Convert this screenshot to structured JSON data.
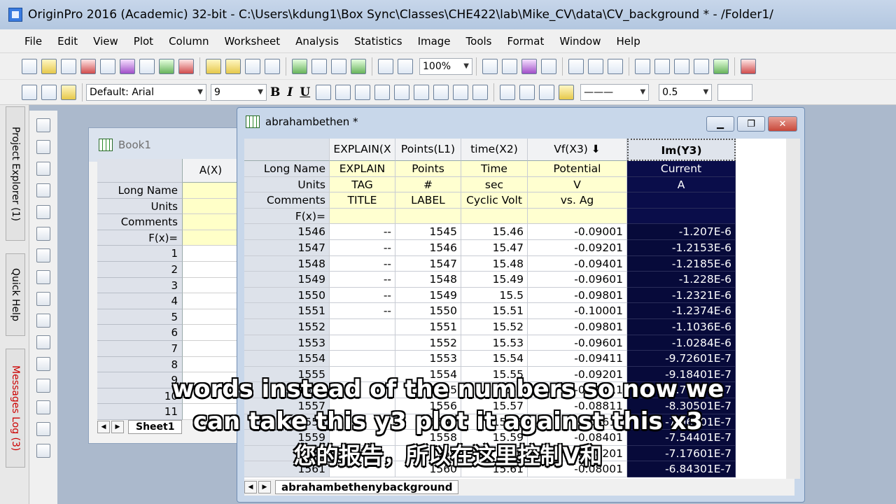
{
  "app": {
    "title": "OriginPro 2016 (Academic) 32-bit - C:\\Users\\kdung1\\Box Sync\\Classes\\CHE422\\lab\\Mike_CV\\data\\CV_background * - /Folder1/"
  },
  "menu": [
    "File",
    "Edit",
    "View",
    "Plot",
    "Column",
    "Worksheet",
    "Analysis",
    "Statistics",
    "Image",
    "Tools",
    "Format",
    "Window",
    "Help"
  ],
  "toolbar": {
    "zoom": "100%",
    "font": "Default: Arial",
    "size": "9",
    "line_width": "0.5"
  },
  "dock_tabs": [
    "Project Explorer (1)",
    "Quick Help",
    "Messages Log (3)"
  ],
  "book1": {
    "title": "Book1",
    "column": "A(X)",
    "labels": [
      "Long Name",
      "Units",
      "Comments",
      "F(x)=",
      "1",
      "2",
      "3",
      "4",
      "5",
      "6",
      "7",
      "8",
      "9",
      "10",
      "11"
    ],
    "sheet_tab": "Sheet1"
  },
  "workbook": {
    "title": "abrahambethen *",
    "sheet_tab": "abrahambethenybackground",
    "columns": [
      "EXPLAIN(X",
      "Points(L1)",
      "time(X2)",
      "Vf(X3)",
      "Im(Y3)"
    ],
    "long_name": [
      "EXPLAIN",
      "Points",
      "Time",
      "Potential",
      "Current"
    ],
    "units": [
      "TAG",
      "#",
      "sec",
      "V",
      "A"
    ],
    "comments": [
      "TITLE",
      "LABEL",
      "Cyclic Volt",
      "vs. Ag",
      ""
    ],
    "meta_labels": [
      "Long Name",
      "Units",
      "Comments",
      "F(x)="
    ],
    "rows": [
      [
        "1546",
        "--",
        "1545",
        "15.46",
        "-0.09001",
        "-1.207E-6"
      ],
      [
        "1547",
        "--",
        "1546",
        "15.47",
        "-0.09201",
        "-1.2153E-6"
      ],
      [
        "1548",
        "--",
        "1547",
        "15.48",
        "-0.09401",
        "-1.2185E-6"
      ],
      [
        "1549",
        "--",
        "1548",
        "15.49",
        "-0.09601",
        "-1.228E-6"
      ],
      [
        "1550",
        "--",
        "1549",
        "15.5",
        "-0.09801",
        "-1.2321E-6"
      ],
      [
        "1551",
        "--",
        "1550",
        "15.51",
        "-0.10001",
        "-1.2374E-6"
      ],
      [
        "1552",
        "",
        "1551",
        "15.52",
        "-0.09801",
        "-1.1036E-6"
      ],
      [
        "1553",
        "",
        "1552",
        "15.53",
        "-0.09601",
        "-1.0284E-6"
      ],
      [
        "1554",
        "",
        "1553",
        "15.54",
        "-0.09411",
        "-9.72601E-7"
      ],
      [
        "1555",
        "",
        "1554",
        "15.55",
        "-0.09201",
        "-9.18401E-7"
      ],
      [
        "1556",
        "",
        "1555",
        "15.56",
        "-0.09011",
        "-8.77401E-7"
      ],
      [
        "1557",
        "",
        "1556",
        "15.57",
        "-0.08811",
        "-8.30501E-7"
      ],
      [
        "1558",
        "",
        "1557",
        "15.58",
        "-0.08611",
        "-7.96001E-7"
      ],
      [
        "1559",
        "",
        "1558",
        "15.59",
        "-0.08401",
        "-7.54401E-7"
      ],
      [
        "1560",
        "",
        "1559",
        "15.6",
        "-0.08201",
        "-7.17601E-7"
      ],
      [
        "1561",
        "",
        "1560",
        "15.61",
        "-0.08001",
        "-6.84301E-7"
      ]
    ]
  },
  "subtitles": {
    "line1": "words instead of the numbers so now we",
    "line2": "can take this y3 plot it against this x3",
    "line3": "您的报告，所以在这里控制V和"
  }
}
